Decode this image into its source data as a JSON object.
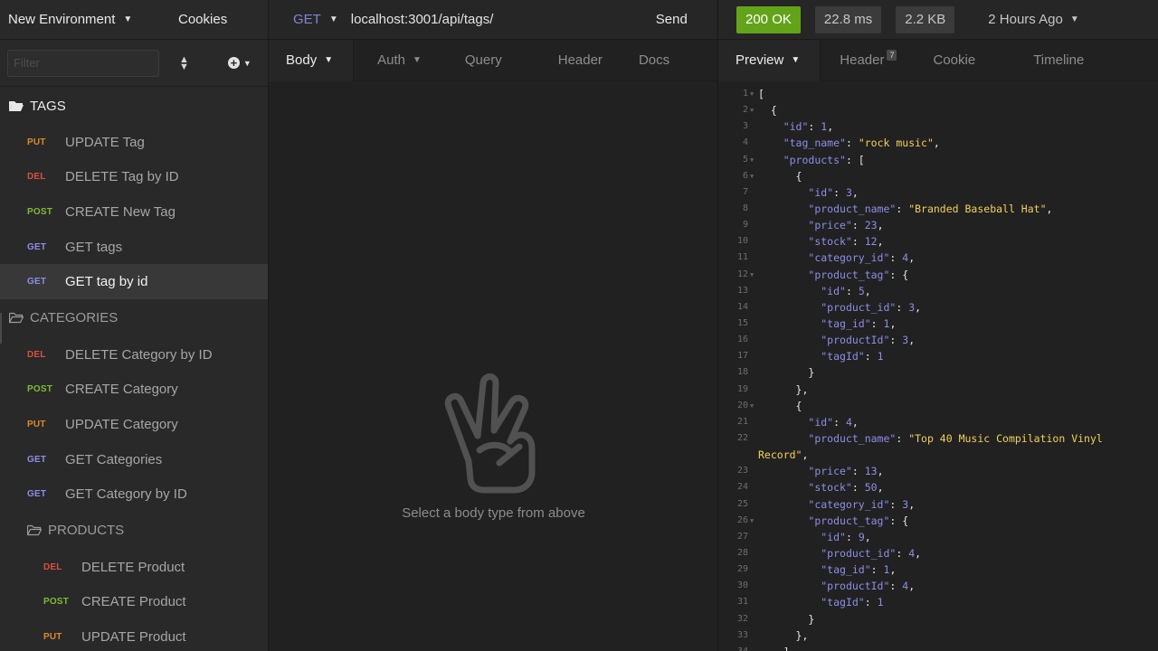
{
  "sidebar": {
    "environment_label": "New Environment",
    "cookies_label": "Cookies",
    "filter_placeholder": "Filter",
    "folders": {
      "tags": "TAGS",
      "categories": "CATEGORIES",
      "products": "PRODUCTS"
    },
    "tags_requests": [
      {
        "method": "PUT",
        "name": "UPDATE Tag"
      },
      {
        "method": "DEL",
        "name": "DELETE Tag by ID"
      },
      {
        "method": "POST",
        "name": "CREATE New Tag"
      },
      {
        "method": "GET",
        "name": "GET tags"
      },
      {
        "method": "GET",
        "name": "GET tag by id",
        "selected": true
      }
    ],
    "categories_requests": [
      {
        "method": "DEL",
        "name": "DELETE Category by ID"
      },
      {
        "method": "POST",
        "name": "CREATE Category"
      },
      {
        "method": "PUT",
        "name": "UPDATE Category"
      },
      {
        "method": "GET",
        "name": "GET Categories"
      },
      {
        "method": "GET",
        "name": "GET Category by ID"
      }
    ],
    "products_requests": [
      {
        "method": "DEL",
        "name": "DELETE Product"
      },
      {
        "method": "POST",
        "name": "CREATE Product"
      },
      {
        "method": "PUT",
        "name": "UPDATE Product"
      }
    ]
  },
  "request": {
    "method": "GET",
    "url": "localhost:3001/api/tags/",
    "send_label": "Send",
    "tabs": {
      "body": "Body",
      "auth": "Auth",
      "query": "Query",
      "header": "Header",
      "docs": "Docs"
    },
    "empty_state": "Select a body type from above",
    "empty_icon": "peace-hand-icon"
  },
  "response": {
    "status": "200 OK",
    "time": "22.8 ms",
    "size": "2.2 KB",
    "history": "2 Hours Ago",
    "tabs": {
      "preview": "Preview",
      "header": "Header",
      "header_count": "7",
      "cookie": "Cookie",
      "timeline": "Timeline"
    },
    "lines": [
      {
        "n": "1",
        "fold": true,
        "text": "["
      },
      {
        "n": "2",
        "fold": true,
        "text": "  {"
      },
      {
        "n": "3",
        "text": "    \"id\": 1,"
      },
      {
        "n": "4",
        "text": "    \"tag_name\": \"rock music\","
      },
      {
        "n": "5",
        "fold": true,
        "text": "    \"products\": ["
      },
      {
        "n": "6",
        "fold": true,
        "text": "      {"
      },
      {
        "n": "7",
        "text": "        \"id\": 3,"
      },
      {
        "n": "8",
        "text": "        \"product_name\": \"Branded Baseball Hat\","
      },
      {
        "n": "9",
        "text": "        \"price\": 23,"
      },
      {
        "n": "10",
        "text": "        \"stock\": 12,"
      },
      {
        "n": "11",
        "text": "        \"category_id\": 4,"
      },
      {
        "n": "12",
        "fold": true,
        "text": "        \"product_tag\": {"
      },
      {
        "n": "13",
        "text": "          \"id\": 5,"
      },
      {
        "n": "14",
        "text": "          \"product_id\": 3,"
      },
      {
        "n": "15",
        "text": "          \"tag_id\": 1,"
      },
      {
        "n": "16",
        "text": "          \"productId\": 3,"
      },
      {
        "n": "17",
        "text": "          \"tagId\": 1"
      },
      {
        "n": "18",
        "text": "        }"
      },
      {
        "n": "19",
        "text": "      },"
      },
      {
        "n": "20",
        "fold": true,
        "text": "      {"
      },
      {
        "n": "21",
        "text": "        \"id\": 4,"
      },
      {
        "n": "22",
        "text": "        \"product_name\": \"Top 40 Music Compilation Vinyl"
      },
      {
        "n": "",
        "text": "Record\","
      },
      {
        "n": "23",
        "text": "        \"price\": 13,"
      },
      {
        "n": "24",
        "text": "        \"stock\": 50,"
      },
      {
        "n": "25",
        "text": "        \"category_id\": 3,"
      },
      {
        "n": "26",
        "fold": true,
        "text": "        \"product_tag\": {"
      },
      {
        "n": "27",
        "text": "          \"id\": 9,"
      },
      {
        "n": "28",
        "text": "          \"product_id\": 4,"
      },
      {
        "n": "29",
        "text": "          \"tag_id\": 1,"
      },
      {
        "n": "30",
        "text": "          \"productId\": 4,"
      },
      {
        "n": "31",
        "text": "          \"tagId\": 1"
      },
      {
        "n": "32",
        "text": "        }"
      },
      {
        "n": "33",
        "text": "      },"
      },
      {
        "n": "34",
        "text": "    ]"
      }
    ]
  },
  "colors": {
    "GET": "#8d8ee8",
    "PUT": "#d88a2c",
    "DEL": "#d9503e",
    "POST": "#7fba36",
    "status_ok": "#63a31a"
  }
}
